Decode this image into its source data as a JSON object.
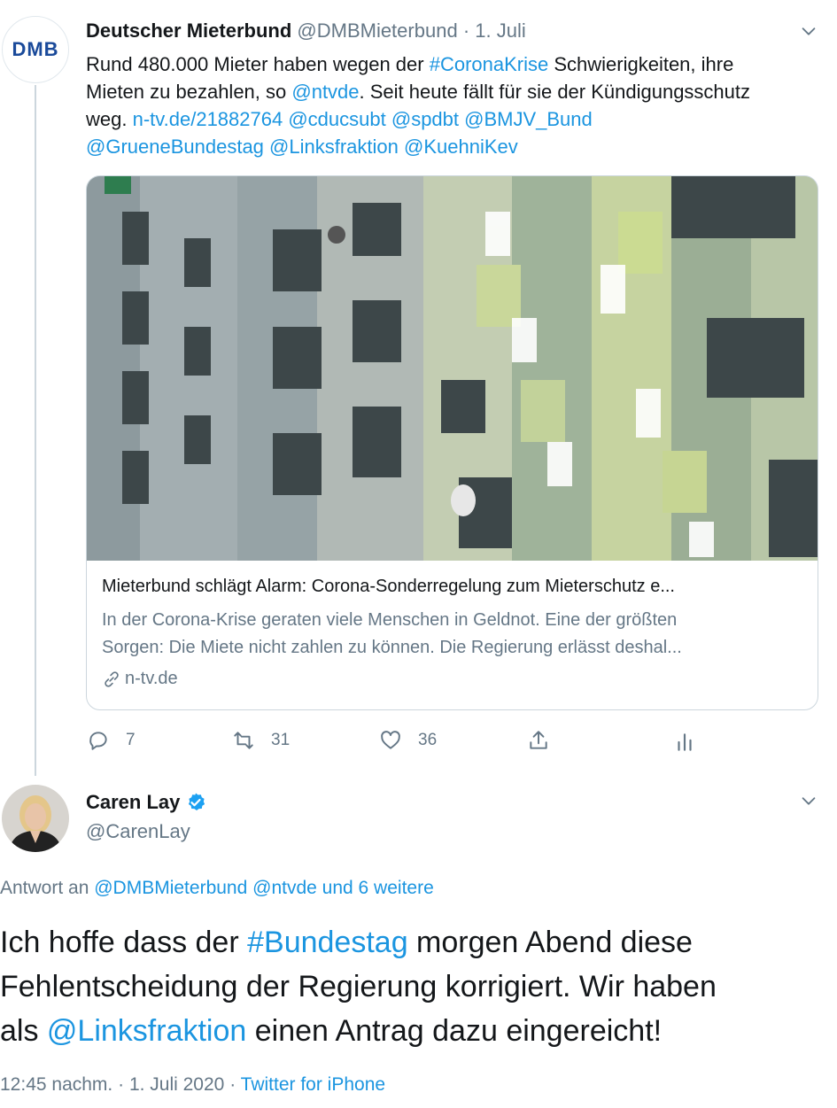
{
  "original_tweet": {
    "author_name": "Deutscher Mieterbund",
    "author_handle": "@DMBMieterbund",
    "separator": "·",
    "date": "1. Juli",
    "avatar_text": "DMB",
    "text": {
      "t1": "Rund 480.000 Mieter haben wegen der ",
      "hashtag_corona": "#CoronaKrise",
      "t2": " Schwierigkeiten, ihre",
      "t3": "Mieten zu bezahlen, so ",
      "mention_ntvde": "@ntvde",
      "t4": ". Seit heute fällt für sie der Kündigungsschutz",
      "t5": "weg. ",
      "link_ntv": "n-tv.de/21882764",
      "mention_cducsubt": "@cducsubt",
      "mention_spdbt": "@spdbt",
      "mention_bmjv": "@BMJV_Bund",
      "mention_gruene": "@GrueneBundestag",
      "mention_linksfraktion": "@Linksfraktion",
      "mention_kuehni": "@KuehniKev"
    },
    "card": {
      "title": "Mieterbund schlägt Alarm: Corona-Sonderregelung zum Mieterschutz e...",
      "description_line1": "In der Corona-Krise geraten viele Menschen in Geldnot. Eine der größten",
      "description_line2": "Sorgen: Die Miete nicht zahlen zu können. Die Regierung erlässt deshal...",
      "domain": "n-tv.de",
      "image_icon": "apartment-building-photo"
    },
    "actions": {
      "reply_count": "7",
      "retweet_count": "31",
      "like_count": "36"
    }
  },
  "reply_tweet": {
    "author_name": "Caren Lay",
    "author_handle": "@CarenLay",
    "verified_icon": "verified-badge-icon",
    "reply_to": {
      "prefix": "Antwort an ",
      "mention1": "@DMBMieterbund",
      "mention2": "@ntvde",
      "suffix": "und 6 weitere"
    },
    "text": {
      "t1": "Ich hoffe dass der ",
      "hashtag_bundestag": "#Bundestag",
      "t2": " morgen Abend diese",
      "t3": "Fehlentscheidung der Regierung korrigiert. Wir haben",
      "t4": "als ",
      "mention_linksfraktion": "@Linksfraktion",
      "t5": " einen Antrag dazu eingereicht!"
    },
    "meta": {
      "time": "12:45 nachm.",
      "separator1": " · ",
      "date": "1. Juli 2020",
      "separator2": " · ",
      "source": "Twitter for iPhone"
    }
  },
  "colors": {
    "link": "#1b95e0",
    "muted": "#657786",
    "verified": "#1da1f2"
  }
}
